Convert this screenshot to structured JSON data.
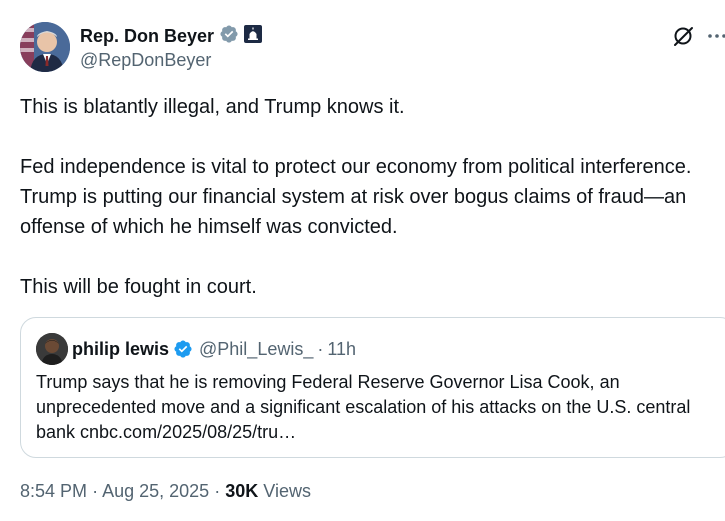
{
  "author": {
    "display_name": "Rep. Don Beyer",
    "handle": "@RepDonBeyer",
    "verified_badge_color": "#829aab",
    "affiliation_badge_color": "#1d2a44"
  },
  "tweet": {
    "paragraphs": [
      "This is blatantly illegal, and Trump knows it.",
      "Fed independence is vital to protect our economy from political interference. Trump is putting our financial system at risk over bogus claims of fraud—an offense of which he himself was convicted.",
      "This will be fought in court."
    ]
  },
  "quote": {
    "display_name": "philip lewis",
    "handle": "@Phil_Lewis_",
    "separator": "·",
    "time": "11h",
    "verified_badge_color": "#1d9bf0",
    "text": "Trump says that he is removing Federal Reserve Governor Lisa Cook, an unprecedented move and a significant escalation of his attacks on the U.S. central bank cnbc.com/2025/08/25/tru…"
  },
  "meta": {
    "time": "8:54 PM",
    "date": "Aug 25, 2025",
    "separator": "·",
    "views_count": "30K",
    "views_label": "Views"
  },
  "icons": {
    "grok": "grok-icon",
    "more": "more-icon"
  },
  "colors": {
    "text": "#0f1419",
    "secondary": "#536471",
    "border": "#cfd9de"
  }
}
